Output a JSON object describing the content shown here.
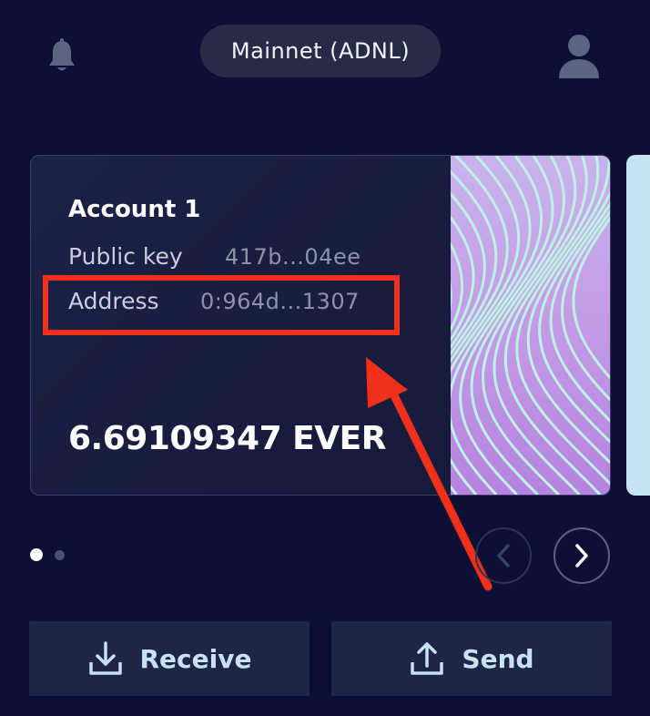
{
  "header": {
    "network_label": "Mainnet (ADNL)"
  },
  "account_card": {
    "name": "Account 1",
    "public_key_label": "Public key",
    "public_key_value": "417b...04ee",
    "address_label": "Address",
    "address_value": "0:964d...1307",
    "balance": "6.69109347 EVER"
  },
  "carousel": {
    "page_count": 2,
    "active_page": 1
  },
  "actions": {
    "receive_label": "Receive",
    "send_label": "Send"
  },
  "icons": {
    "bell": "bell-icon",
    "profile": "user-avatar-icon",
    "prev": "chevron-left-icon",
    "next": "chevron-right-icon",
    "receive": "download-tray-icon",
    "send": "upload-tray-icon"
  },
  "colors": {
    "background": "#0b1034",
    "card": "#1a1f42",
    "accent_text": "#c7e2f3",
    "annotation_red": "#f0301a"
  }
}
